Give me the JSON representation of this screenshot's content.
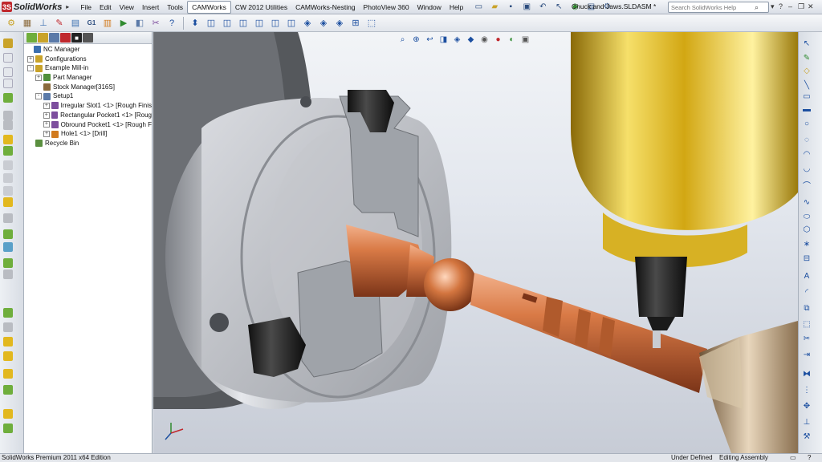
{
  "menubar": {
    "app_name": "SolidWorks",
    "items": [
      "File",
      "Edit",
      "View",
      "Insert",
      "Tools",
      "CAMWorks",
      "CW 2012 Utilities",
      "CAMWorks-Nesting",
      "PhotoView 360",
      "Window",
      "Help"
    ],
    "active_item": "CAMWorks",
    "document_title": "Chuck and Jaws.SLDASM *",
    "search_placeholder": "Search SolidWorks Help"
  },
  "tree": {
    "rows": [
      {
        "label": "NC Manager",
        "expander": "",
        "icon_color": "#3a6fb0"
      },
      {
        "label": "Configurations",
        "expander": "+",
        "icon_color": "#c9a32a"
      },
      {
        "label": "Example Mill-in",
        "expander": "-",
        "icon_color": "#c9a32a"
      },
      {
        "label": "Part Manager",
        "expander": "+",
        "icon_color": "#4f8f3a"
      },
      {
        "label": "Stock Manager[316S]",
        "expander": "",
        "icon_color": "#8a6a3c"
      },
      {
        "label": "Setup1",
        "expander": "-",
        "icon_color": "#5b7aa8"
      },
      {
        "label": "Irregular Slot1 <1> [Rough Finis",
        "expander": "+",
        "icon_color": "#7d4e9e"
      },
      {
        "label": "Rectangular Pocket1 <1> [Roug",
        "expander": "+",
        "icon_color": "#7d4e9e"
      },
      {
        "label": "Obround Pocket1 <1> [Rough F",
        "expander": "+",
        "icon_color": "#7d4e9e"
      },
      {
        "label": "Hole1 <1> [Drill]",
        "expander": "+",
        "icon_color": "#d17a1e"
      },
      {
        "label": "Recycle Bin",
        "expander": "",
        "icon_color": "#5a8f3f"
      }
    ]
  },
  "viewport": {
    "scene": "lathe-chuck-with-copper-workpiece-and-milling-spindle",
    "colors": {
      "chuck": "#b9bcc2",
      "jaws": "#3a3d42",
      "workpiece": "#c8693a",
      "spindle": "#e2b81f",
      "tailstock": "#b38a5a"
    }
  },
  "statusbar": {
    "edition": "SolidWorks Premium 2011 x64 Edition",
    "definition": "Under Defined",
    "mode": "Editing Assembly"
  }
}
